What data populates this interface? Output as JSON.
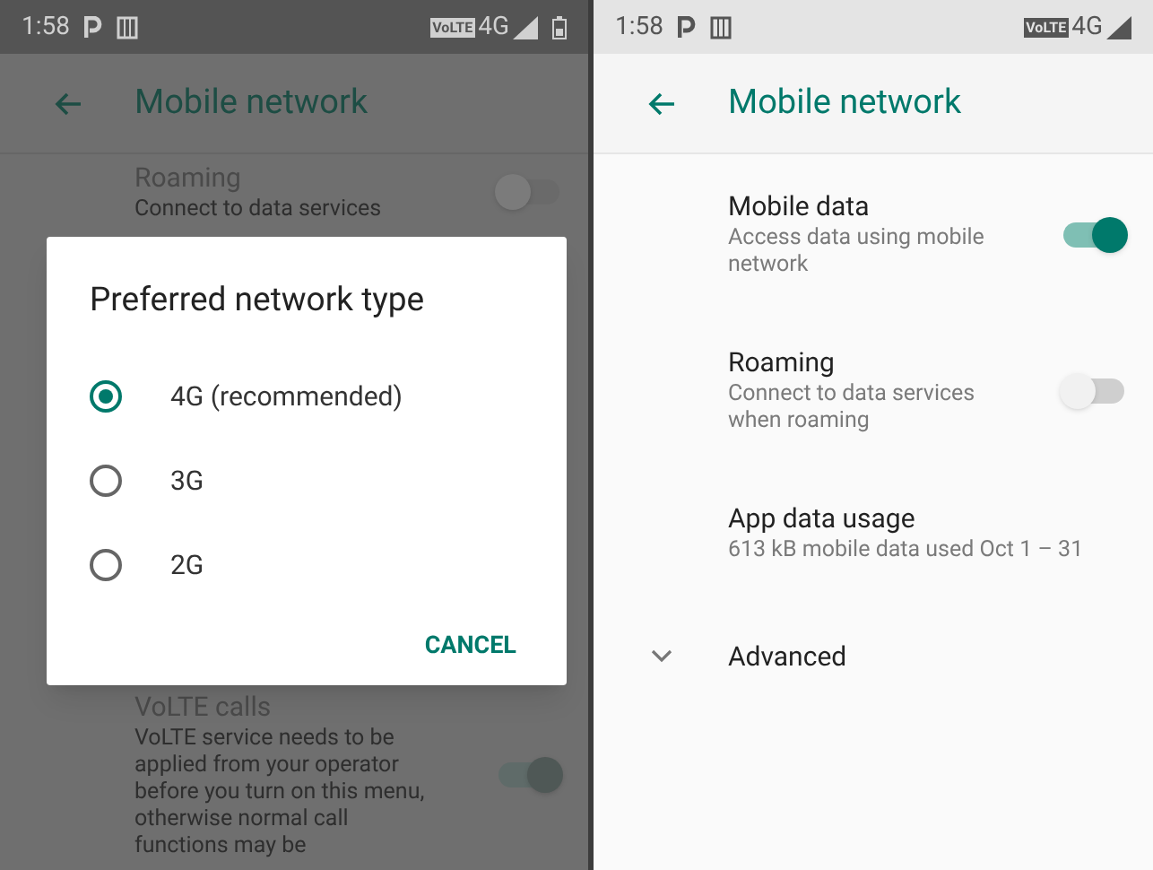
{
  "screens": [
    {
      "dimmed": true,
      "status_bar": {
        "time": "1:58",
        "volte": "VoLTE",
        "network": "4G",
        "battery": true
      },
      "toolbar": {
        "title": "Mobile network"
      },
      "settings": [
        {
          "kind": "switch",
          "title": "Roaming",
          "summary": "Connect to data services",
          "on": false
        },
        {
          "kind": "switch",
          "title": "VoLTE calls",
          "summary": "VoLTE service needs to be applied from your operator before you turn on this menu, otherwise normal call functions may be",
          "on": true
        }
      ],
      "dialog": {
        "title": "Preferred network type",
        "options": [
          {
            "label": "4G (recommended)",
            "selected": true
          },
          {
            "label": "3G",
            "selected": false
          },
          {
            "label": "2G",
            "selected": false
          }
        ],
        "button": "CANCEL"
      }
    },
    {
      "dimmed": false,
      "status_bar": {
        "time": "1:58",
        "volte": "VoLTE",
        "network": "4G",
        "battery": false
      },
      "toolbar": {
        "title": "Mobile network"
      },
      "settings": [
        {
          "kind": "switch",
          "title": "Mobile data",
          "summary": "Access data using mobile network",
          "on": true
        },
        {
          "kind": "switch",
          "title": "Roaming",
          "summary": "Connect to data services when roaming",
          "on": false
        },
        {
          "kind": "text",
          "title": "App data usage",
          "summary": "613 kB mobile data used Oct 1 – 31"
        },
        {
          "kind": "expander",
          "title": "Advanced",
          "expanded": false
        }
      ]
    }
  ]
}
